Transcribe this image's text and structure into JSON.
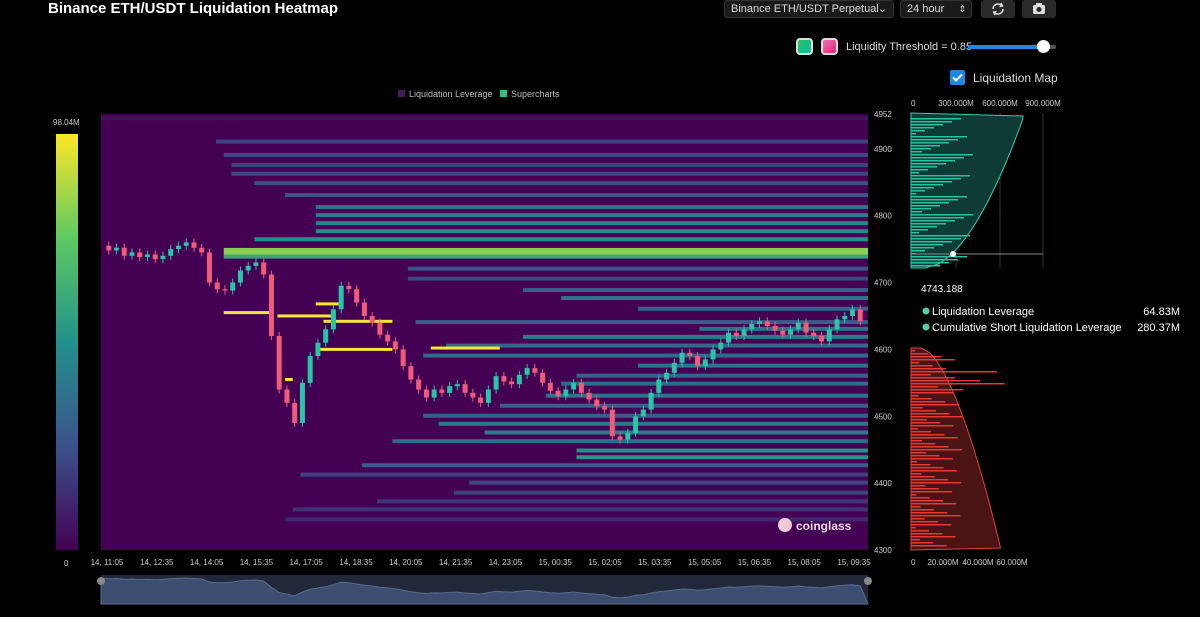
{
  "header": {
    "title": "Binance ETH/USDT Liquidation Heatmap",
    "pair_select": "Binance ETH/USDT Perpetual",
    "interval_select": "24 hour",
    "refresh_icon": "refresh-icon",
    "camera_icon": "camera-icon"
  },
  "controls": {
    "threshold_label": "Liquidity Threshold = 0.85",
    "threshold_value": 0.85,
    "liquidation_map_label": "Liquidation Map",
    "liquidation_map_checked": true
  },
  "legend": {
    "leverage": "Liquidation Leverage",
    "supercharts": "Supercharts"
  },
  "colorbar": {
    "max_label": "98.04M",
    "min_label": "0"
  },
  "watermark": "coinglass",
  "tooltip": {
    "price": "4743.188",
    "row1_label": "Liquidation Leverage",
    "row1_value": "64.83M",
    "row2_label": "Cumulative Short Liquidation Leverage",
    "row2_value": "280.37M"
  },
  "chart_data": [
    {
      "type": "heatmap",
      "title": "",
      "x_ticks": [
        "14, 11:05",
        "14, 12:35",
        "14, 14:05",
        "14, 15:35",
        "14, 17:05",
        "14, 18:35",
        "14, 20:05",
        "14, 21:35",
        "14, 23:05",
        "15, 00:35",
        "15, 02:05",
        "15, 03:35",
        "15, 05:05",
        "15, 06:35",
        "15, 08:05",
        "15, 09:35"
      ],
      "y_ticks": [
        4952,
        4900,
        4800,
        4700,
        4600,
        4500,
        4400,
        4300
      ],
      "ylim": [
        4300,
        4952
      ],
      "colorscale_range": [
        0,
        98.04
      ],
      "bands": [
        {
          "price": 4945,
          "start": 0.0,
          "intensity": 0.05
        },
        {
          "price": 4910,
          "start": 0.15,
          "intensity": 0.2
        },
        {
          "price": 4890,
          "start": 0.16,
          "intensity": 0.22
        },
        {
          "price": 4875,
          "start": 0.17,
          "intensity": 0.2
        },
        {
          "price": 4862,
          "start": 0.17,
          "intensity": 0.22
        },
        {
          "price": 4848,
          "start": 0.2,
          "intensity": 0.24
        },
        {
          "price": 4830,
          "start": 0.24,
          "intensity": 0.26
        },
        {
          "price": 4812,
          "start": 0.28,
          "intensity": 0.38
        },
        {
          "price": 4800,
          "start": 0.28,
          "intensity": 0.42
        },
        {
          "price": 4788,
          "start": 0.28,
          "intensity": 0.45
        },
        {
          "price": 4776,
          "start": 0.28,
          "intensity": 0.48
        },
        {
          "price": 4764,
          "start": 0.2,
          "intensity": 0.5
        },
        {
          "price": 4748,
          "start": 0.16,
          "intensity": 0.82
        },
        {
          "price": 4738,
          "start": 0.16,
          "intensity": 0.6
        },
        {
          "price": 4720,
          "start": 0.4,
          "intensity": 0.25
        },
        {
          "price": 4705,
          "start": 0.4,
          "intensity": 0.22
        },
        {
          "price": 4688,
          "start": 0.55,
          "intensity": 0.3
        },
        {
          "price": 4676,
          "start": 0.6,
          "intensity": 0.4
        },
        {
          "price": 4660,
          "start": 0.7,
          "intensity": 0.3
        },
        {
          "price": 4640,
          "start": 0.41,
          "intensity": 0.3
        },
        {
          "price": 4630,
          "start": 0.78,
          "intensity": 0.38
        },
        {
          "price": 4618,
          "start": 0.55,
          "intensity": 0.42
        },
        {
          "price": 4605,
          "start": 0.45,
          "intensity": 0.35
        },
        {
          "price": 4590,
          "start": 0.42,
          "intensity": 0.35
        },
        {
          "price": 4575,
          "start": 0.7,
          "intensity": 0.38
        },
        {
          "price": 4560,
          "start": 0.62,
          "intensity": 0.32
        },
        {
          "price": 4548,
          "start": 0.6,
          "intensity": 0.35
        },
        {
          "price": 4530,
          "start": 0.58,
          "intensity": 0.38
        },
        {
          "price": 4515,
          "start": 0.52,
          "intensity": 0.3
        },
        {
          "price": 4500,
          "start": 0.42,
          "intensity": 0.3
        },
        {
          "price": 4488,
          "start": 0.44,
          "intensity": 0.4
        },
        {
          "price": 4475,
          "start": 0.5,
          "intensity": 0.42
        },
        {
          "price": 4462,
          "start": 0.38,
          "intensity": 0.35
        },
        {
          "price": 4448,
          "start": 0.62,
          "intensity": 0.5
        },
        {
          "price": 4438,
          "start": 0.62,
          "intensity": 0.52
        },
        {
          "price": 4426,
          "start": 0.34,
          "intensity": 0.3
        },
        {
          "price": 4412,
          "start": 0.26,
          "intensity": 0.2
        },
        {
          "price": 4400,
          "start": 0.48,
          "intensity": 0.22
        },
        {
          "price": 4385,
          "start": 0.46,
          "intensity": 0.2
        },
        {
          "price": 4372,
          "start": 0.36,
          "intensity": 0.16
        },
        {
          "price": 4360,
          "start": 0.25,
          "intensity": 0.15
        },
        {
          "price": 4345,
          "start": 0.24,
          "intensity": 0.12
        }
      ],
      "price_series": [
        4755,
        4748,
        4752,
        4740,
        4745,
        4738,
        4742,
        4735,
        4740,
        4750,
        4755,
        4760,
        4752,
        4745,
        4700,
        4690,
        4688,
        4700,
        4718,
        4725,
        4730,
        4712,
        4620,
        4540,
        4520,
        4490,
        4550,
        4590,
        4610,
        4630,
        4660,
        4695,
        4690,
        4670,
        4650,
        4640,
        4622,
        4612,
        4600,
        4575,
        4555,
        4540,
        4528,
        4540,
        4535,
        4545,
        4548,
        4535,
        4528,
        4520,
        4540,
        4560,
        4552,
        4548,
        4562,
        4572,
        4565,
        4550,
        4538,
        4530,
        4540,
        4550,
        4535,
        4525,
        4515,
        4510,
        4470,
        4465,
        4475,
        4500,
        4510,
        4535,
        4555,
        4565,
        4580,
        4595,
        4590,
        4575,
        4585,
        4600,
        4610,
        4625,
        4620,
        4630,
        4638,
        4642,
        4635,
        4628,
        4622,
        4630,
        4640,
        4625,
        4620,
        4612,
        4630,
        4645,
        4650,
        4660,
        4642
      ]
    },
    {
      "type": "bar",
      "title": "Liquidation Map",
      "orientation": "horizontal",
      "x_ticks_top": [
        "0",
        "300.000M",
        "600.000M",
        "900.000M"
      ],
      "x_ticks_bottom": [
        "0",
        "20.000M",
        "40.000M",
        "60.000M"
      ],
      "series": [
        {
          "name": "Liquidation Leverage"
        },
        {
          "name": "Cumulative Short Liquidation Leverage"
        }
      ]
    }
  ]
}
